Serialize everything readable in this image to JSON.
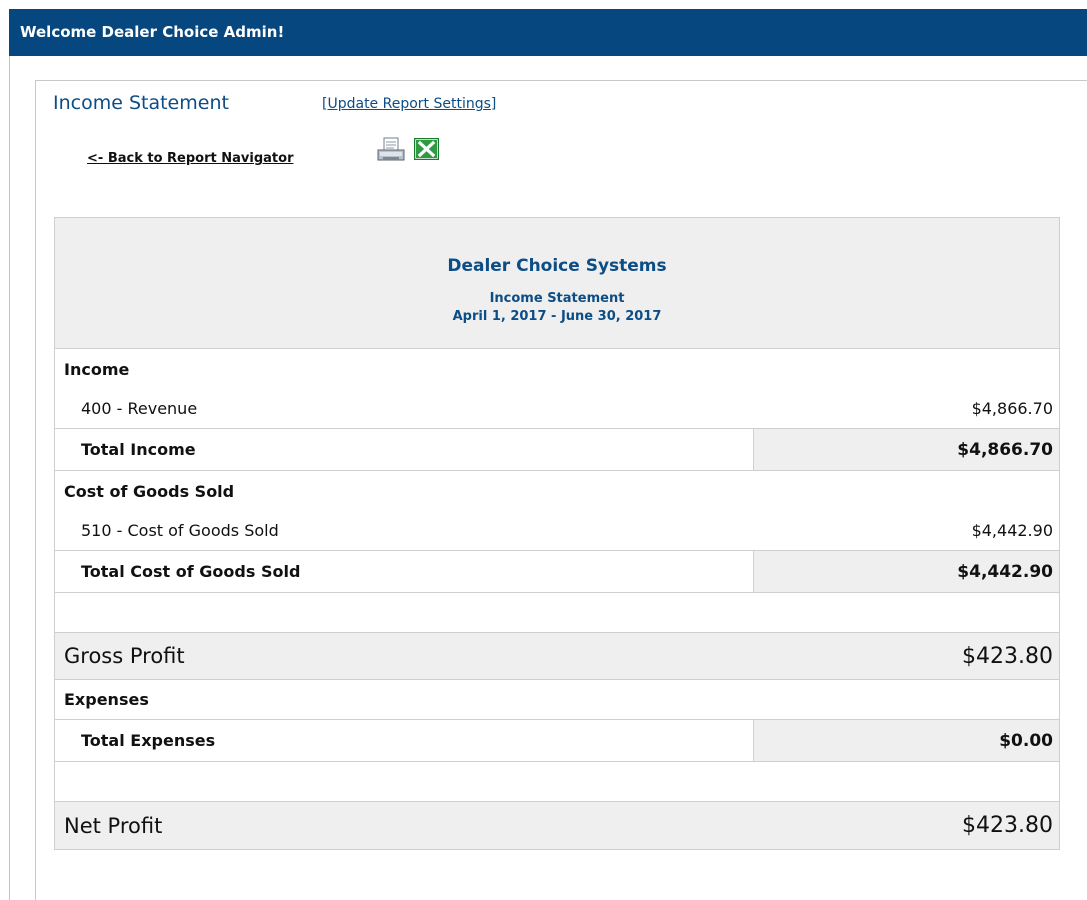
{
  "header": {
    "welcome": "Welcome Dealer Choice Admin!"
  },
  "report_page": {
    "title": "Income Statement",
    "update_link_prefix": "[",
    "update_link_label": "Update Report Settings",
    "update_link_suffix": "]",
    "back_link": "<- Back to Report Navigator",
    "icons": [
      "print-icon",
      "excel-icon"
    ]
  },
  "report": {
    "company": "Dealer Choice Systems",
    "subtitle": "Income Statement",
    "date_range": "April 1, 2017 - June 30, 2017",
    "income": {
      "heading": "Income",
      "items": [
        {
          "label": "400 - Revenue",
          "amount": "$4,866.70"
        }
      ],
      "total_label": "Total Income",
      "total_amount": "$4,866.70"
    },
    "cogs": {
      "heading": "Cost of Goods Sold",
      "items": [
        {
          "label": "510 - Cost of Goods Sold",
          "amount": "$4,442.90"
        }
      ],
      "total_label": "Total Cost of Goods Sold",
      "total_amount": "$4,442.90"
    },
    "gross_profit": {
      "label": "Gross Profit",
      "amount": "$423.80"
    },
    "expenses": {
      "heading": "Expenses",
      "total_label": "Total Expenses",
      "total_amount": "$0.00"
    },
    "net_profit": {
      "label": "Net Profit",
      "amount": "$423.80"
    }
  },
  "colors": {
    "header_bg": "#07477f",
    "title_blue": "#0c4d86",
    "shade": "#efefef"
  }
}
